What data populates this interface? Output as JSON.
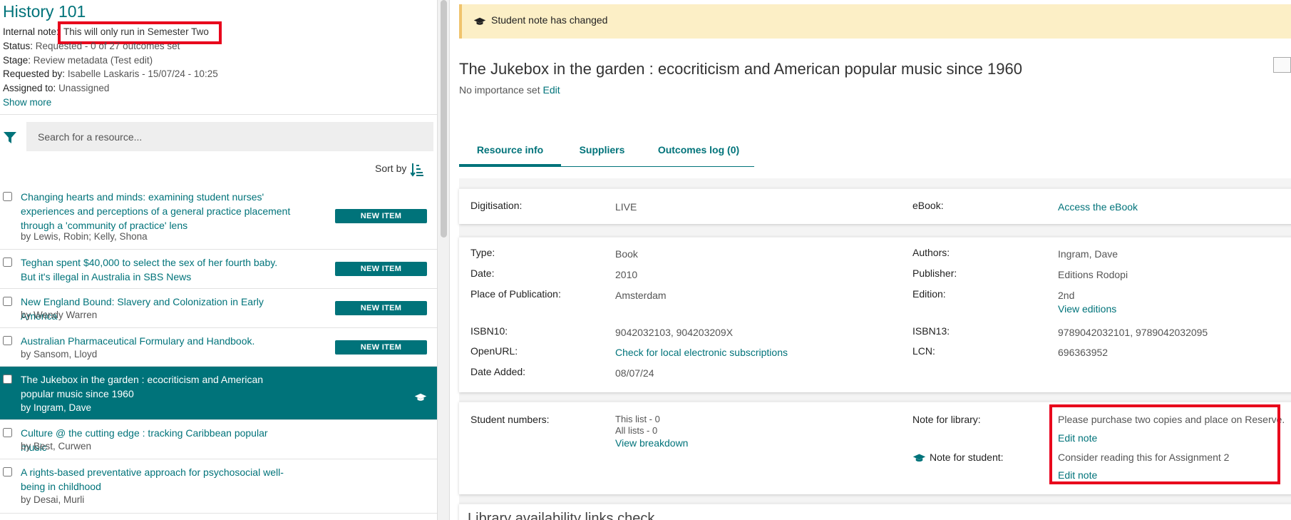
{
  "list": {
    "title": "History 101",
    "internal_note_label": "Internal note:",
    "internal_note": "This will only run in Semester Two",
    "status_label": "Status:",
    "status": "Requested - 0 of 27 outcomes set",
    "stage_label": "Stage:",
    "stage": "Review metadata (Test edit)",
    "requested_by_label": "Requested by:",
    "requested_by": "Isabelle Laskaris - 15/07/24 - 10:25",
    "assigned_label": "Assigned to:",
    "assigned": "Unassigned",
    "show_more": "Show more",
    "search_placeholder": "Search for a resource...",
    "sort_by": "Sort by"
  },
  "items": [
    {
      "title": "Changing hearts and minds: examining student nurses' experiences and perceptions of a general practice placement through a 'community of practice' lens",
      "authors": "by Lewis, Robin; Kelly, Shona",
      "badge": "NEW ITEM"
    },
    {
      "title": "Teghan spent $40,000 to select the sex of her fourth baby. But it's illegal in Australia in SBS News",
      "authors": "",
      "badge": "NEW ITEM"
    },
    {
      "title": "New England Bound: Slavery and Colonization in Early America",
      "authors": "by Wendy Warren",
      "badge": "NEW ITEM"
    },
    {
      "title": "Australian Pharmaceutical Formulary and Handbook.",
      "authors": "by Sansom, Lloyd",
      "badge": "NEW ITEM"
    },
    {
      "title": "The Jukebox in the garden : ecocriticism and American popular music since 1960",
      "authors": "by Ingram, Dave",
      "badge": ""
    },
    {
      "title": "Culture @ the cutting edge : tracking Caribbean popular music",
      "authors": "by Best, Curwen",
      "badge": ""
    },
    {
      "title": "A rights-based preventative approach for psychosocial well-being in childhood",
      "authors": "by Desai, Murli",
      "badge": ""
    }
  ],
  "detail": {
    "alert": "Student note has changed",
    "title": "The Jukebox in the garden : ecocriticism and American popular music since 1960",
    "importance": "No importance set",
    "importance_edit": "Edit",
    "tabs": [
      "Resource info",
      "Suppliers",
      "Outcomes log (0)"
    ],
    "digitisation_label": "Digitisation:",
    "digitisation": "LIVE",
    "ebook_label": "eBook:",
    "ebook": "Access the eBook",
    "type_label": "Type:",
    "type": "Book",
    "date_label": "Date:",
    "date": "2010",
    "place_label": "Place of Publication:",
    "place": "Amsterdam",
    "isbn10_label": "ISBN10:",
    "isbn10": "9042032103, 904203209X",
    "openurl_label": "OpenURL:",
    "openurl": "Check for local electronic subscriptions",
    "date_added_label": "Date Added:",
    "date_added": "08/07/24",
    "authors_label": "Authors:",
    "authors": "Ingram, Dave",
    "publisher_label": "Publisher:",
    "publisher": "Editions Rodopi",
    "edition_label": "Edition:",
    "edition": "2nd",
    "view_editions": "View editions",
    "isbn13_label": "ISBN13:",
    "isbn13": "9789042032101, 9789042032095",
    "lcn_label": "LCN:",
    "lcn": "696363952",
    "student_numbers_label": "Student numbers:",
    "this_list": "This list - 0",
    "all_lists": "All lists - 0",
    "view_breakdown": "View breakdown",
    "note_library_label": "Note for library:",
    "note_library": "Please purchase two copies and place on Reserve.",
    "edit_note_1": "Edit note",
    "note_student_label": "Note for student:",
    "note_student": "Consider reading this for Assignment 2",
    "edit_note_2": "Edit note",
    "peek_heading": "Library availability links check"
  },
  "colors": {
    "accent": "#00737a",
    "alert_bg": "#fcefc6",
    "highlight": "#e8001c"
  }
}
